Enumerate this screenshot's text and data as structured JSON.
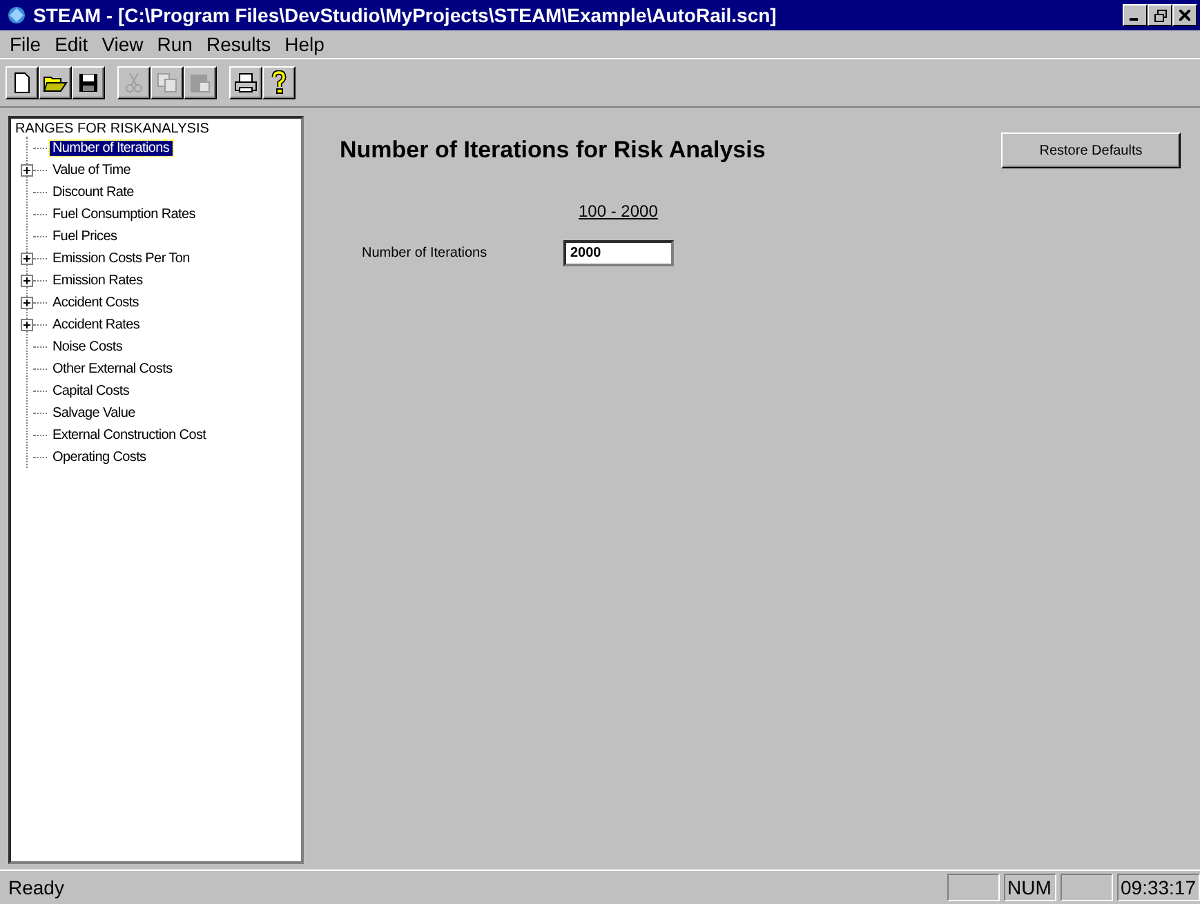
{
  "window": {
    "title": "STEAM  -  [C:\\Program Files\\DevStudio\\MyProjects\\STEAM\\Example\\AutoRail.scn]"
  },
  "menu": [
    "File",
    "Edit",
    "View",
    "Run",
    "Results",
    "Help"
  ],
  "toolbar": [
    [
      {
        "kind": "new",
        "disabled": false
      },
      {
        "kind": "open",
        "disabled": false
      },
      {
        "kind": "save",
        "disabled": false
      }
    ],
    [
      {
        "kind": "cut",
        "disabled": true
      },
      {
        "kind": "copy",
        "disabled": true
      },
      {
        "kind": "paste",
        "disabled": true
      }
    ],
    [
      {
        "kind": "print",
        "disabled": false
      },
      {
        "kind": "help",
        "disabled": false
      }
    ]
  ],
  "tree": {
    "root": "RANGES FOR RISKANALYSIS",
    "items": [
      {
        "label": "Number of Iterations",
        "selected": true,
        "expandable": false
      },
      {
        "label": "Value of Time",
        "selected": false,
        "expandable": true
      },
      {
        "label": "Discount Rate",
        "selected": false,
        "expandable": false
      },
      {
        "label": "Fuel Consumption Rates",
        "selected": false,
        "expandable": false
      },
      {
        "label": "Fuel Prices",
        "selected": false,
        "expandable": false
      },
      {
        "label": "Emission Costs Per Ton",
        "selected": false,
        "expandable": true
      },
      {
        "label": "Emission Rates",
        "selected": false,
        "expandable": true
      },
      {
        "label": "Accident Costs",
        "selected": false,
        "expandable": true
      },
      {
        "label": "Accident Rates",
        "selected": false,
        "expandable": true
      },
      {
        "label": "Noise Costs",
        "selected": false,
        "expandable": false
      },
      {
        "label": "Other External Costs",
        "selected": false,
        "expandable": false
      },
      {
        "label": "Capital Costs",
        "selected": false,
        "expandable": false
      },
      {
        "label": "Salvage Value",
        "selected": false,
        "expandable": false
      },
      {
        "label": "External Construction Cost",
        "selected": false,
        "expandable": false
      },
      {
        "label": "Operating Costs",
        "selected": false,
        "expandable": false
      }
    ]
  },
  "panel": {
    "heading": "Number of Iterations for Risk Analysis",
    "restore_button": "Restore Defaults",
    "range": "100 - 2000",
    "field_label": "Number of Iterations",
    "field_value": "2000"
  },
  "status_bar": {
    "message": "Ready",
    "indicator": "NUM",
    "clock": "09:33:17"
  }
}
